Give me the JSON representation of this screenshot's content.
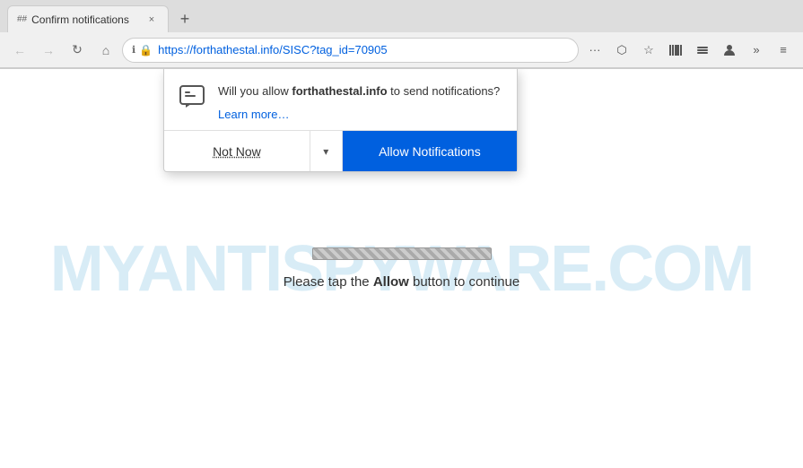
{
  "browser": {
    "tab": {
      "favicon": "##",
      "title": "Confirm notifications",
      "close_label": "×"
    },
    "new_tab_label": "+",
    "nav": {
      "back_label": "←",
      "forward_label": "→",
      "refresh_label": "↻",
      "home_label": "⌂"
    },
    "address_bar": {
      "info_icon": "ℹ",
      "lock_icon": "🔒",
      "url": "https://forthathestal.info/SISC?tag_id=70905"
    },
    "toolbar_right": {
      "more_label": "···",
      "pocket_label": "⬡",
      "star_label": "☆",
      "library_label": "⬛",
      "sync_label": "☁",
      "account_label": "👤",
      "extend_label": "»",
      "menu_label": "≡"
    }
  },
  "notification_popup": {
    "message_prefix": "Will you allow ",
    "site_name": "forthathestal.info",
    "message_suffix": " to send notifications?",
    "learn_more_label": "Learn more…",
    "not_now_label": "Not Now",
    "dropdown_label": "▾",
    "allow_label": "Allow Notifications"
  },
  "page": {
    "watermark": "MYANTISPYWARE.COM",
    "instruction_text_prefix": "Please tap the ",
    "instruction_bold": "Allow",
    "instruction_text_suffix": " button to continue"
  }
}
